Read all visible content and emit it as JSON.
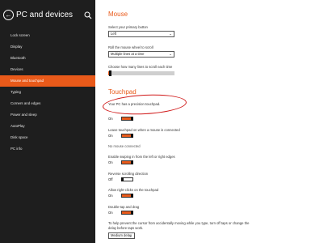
{
  "sidebar": {
    "title": "PC and devices",
    "items": [
      {
        "label": "Lock screen"
      },
      {
        "label": "Display"
      },
      {
        "label": "Bluetooth"
      },
      {
        "label": "Devices"
      },
      {
        "label": "Mouse and touchpad",
        "active": true
      },
      {
        "label": "Typing"
      },
      {
        "label": "Corners and edges"
      },
      {
        "label": "Power and sleep"
      },
      {
        "label": "AutoPlay"
      },
      {
        "label": "Disk space"
      },
      {
        "label": "PC info"
      }
    ]
  },
  "mouse": {
    "title": "Mouse",
    "primary_button_label": "Select your primary button",
    "primary_button_value": "Left",
    "wheel_label": "Roll the mouse wheel to scroll",
    "wheel_value": "Multiple lines at a time",
    "lines_label": "Choose how many lines to scroll each time",
    "lines_fraction": 0.03
  },
  "touchpad": {
    "title": "Touchpad",
    "precision_text": "Your PC has a precision touchpad.",
    "toggle1_state": "On",
    "leave_on_label": "Leave touchpad on when a mouse is connected",
    "leave_on_state": "On",
    "no_mouse_text": "No mouse connected",
    "swiping_label": "Enable swiping in from the left or right edges",
    "swiping_state": "On",
    "reverse_label": "Reverse scrolling direction",
    "reverse_state": "Off",
    "right_click_label": "Allow right-clicks on the touchpad",
    "right_click_state": "On",
    "double_tap_label": "Double-tap and drag",
    "double_tap_state": "On",
    "delay_text_1": "To help prevent the cursor from accidentally moving while you type, turn off taps or change the",
    "delay_text_2": "delay before taps work.",
    "delay_value": "Medium delay"
  },
  "colors": {
    "accent": "#e95a1a",
    "sidebar_bg": "#1e1e1e",
    "annotation": "#d01818"
  }
}
